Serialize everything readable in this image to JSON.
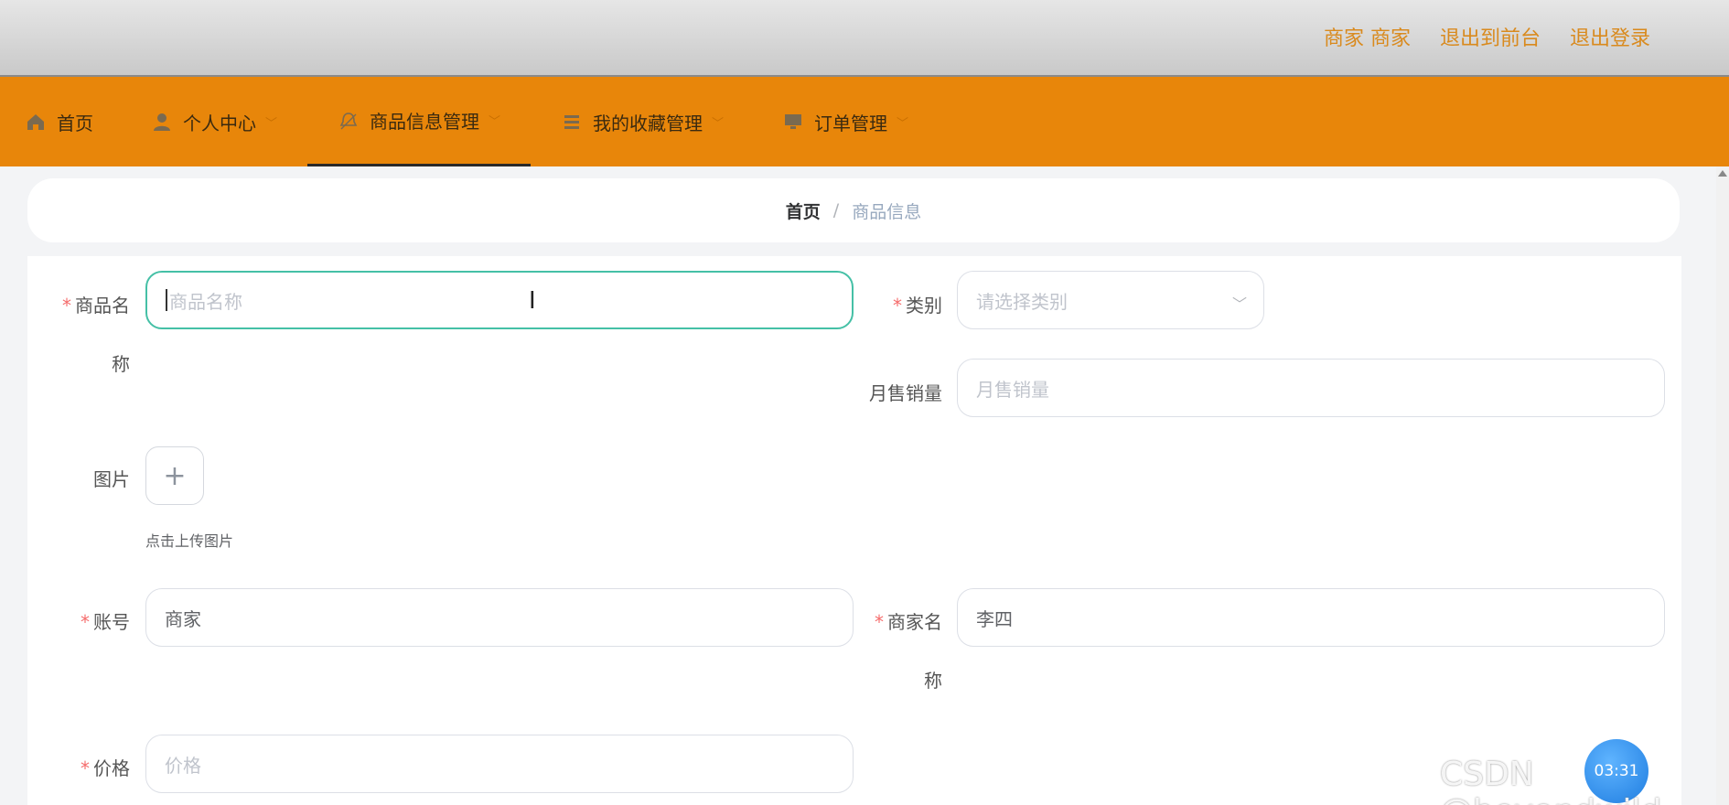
{
  "topbar": {
    "user_label": "商家 商家",
    "to_frontend": "退出到前台",
    "logout": "退出登录"
  },
  "nav": {
    "items": [
      {
        "label": "首页",
        "icon": "home-icon"
      },
      {
        "label": "个人中心",
        "icon": "user-icon"
      },
      {
        "label": "商品信息管理",
        "icon": "bell-icon"
      },
      {
        "label": "我的收藏管理",
        "icon": "list-icon"
      },
      {
        "label": "订单管理",
        "icon": "monitor-icon"
      }
    ],
    "active_index": 2
  },
  "breadcrumb": {
    "home": "首页",
    "separator": "/",
    "current": "商品信息"
  },
  "form": {
    "product_name": {
      "label_line1": "商品名",
      "label_line2": "称",
      "placeholder": "商品名称",
      "required": "*"
    },
    "category": {
      "label": "类别",
      "placeholder": "请选择类别",
      "required": "*"
    },
    "monthly_sales": {
      "label": "月售销量",
      "placeholder": "月售销量"
    },
    "image": {
      "label": "图片",
      "plus": "+",
      "tip": "点击上传图片"
    },
    "account": {
      "label": "账号",
      "value": "商家",
      "required": "*"
    },
    "merchant_name": {
      "label_line1": "商家名",
      "label_line2": "称",
      "value": "李四",
      "required": "*"
    },
    "price": {
      "label": "价格",
      "placeholder": "价格",
      "required": "*"
    }
  },
  "overlay": {
    "timer": "03:31",
    "watermark": "CSDN @beyondwild"
  },
  "colors": {
    "nav_bg": "#e8860a",
    "topbar_link": "#d98a1e",
    "focus_border": "#45c0a6",
    "required": "#f56c6c"
  }
}
